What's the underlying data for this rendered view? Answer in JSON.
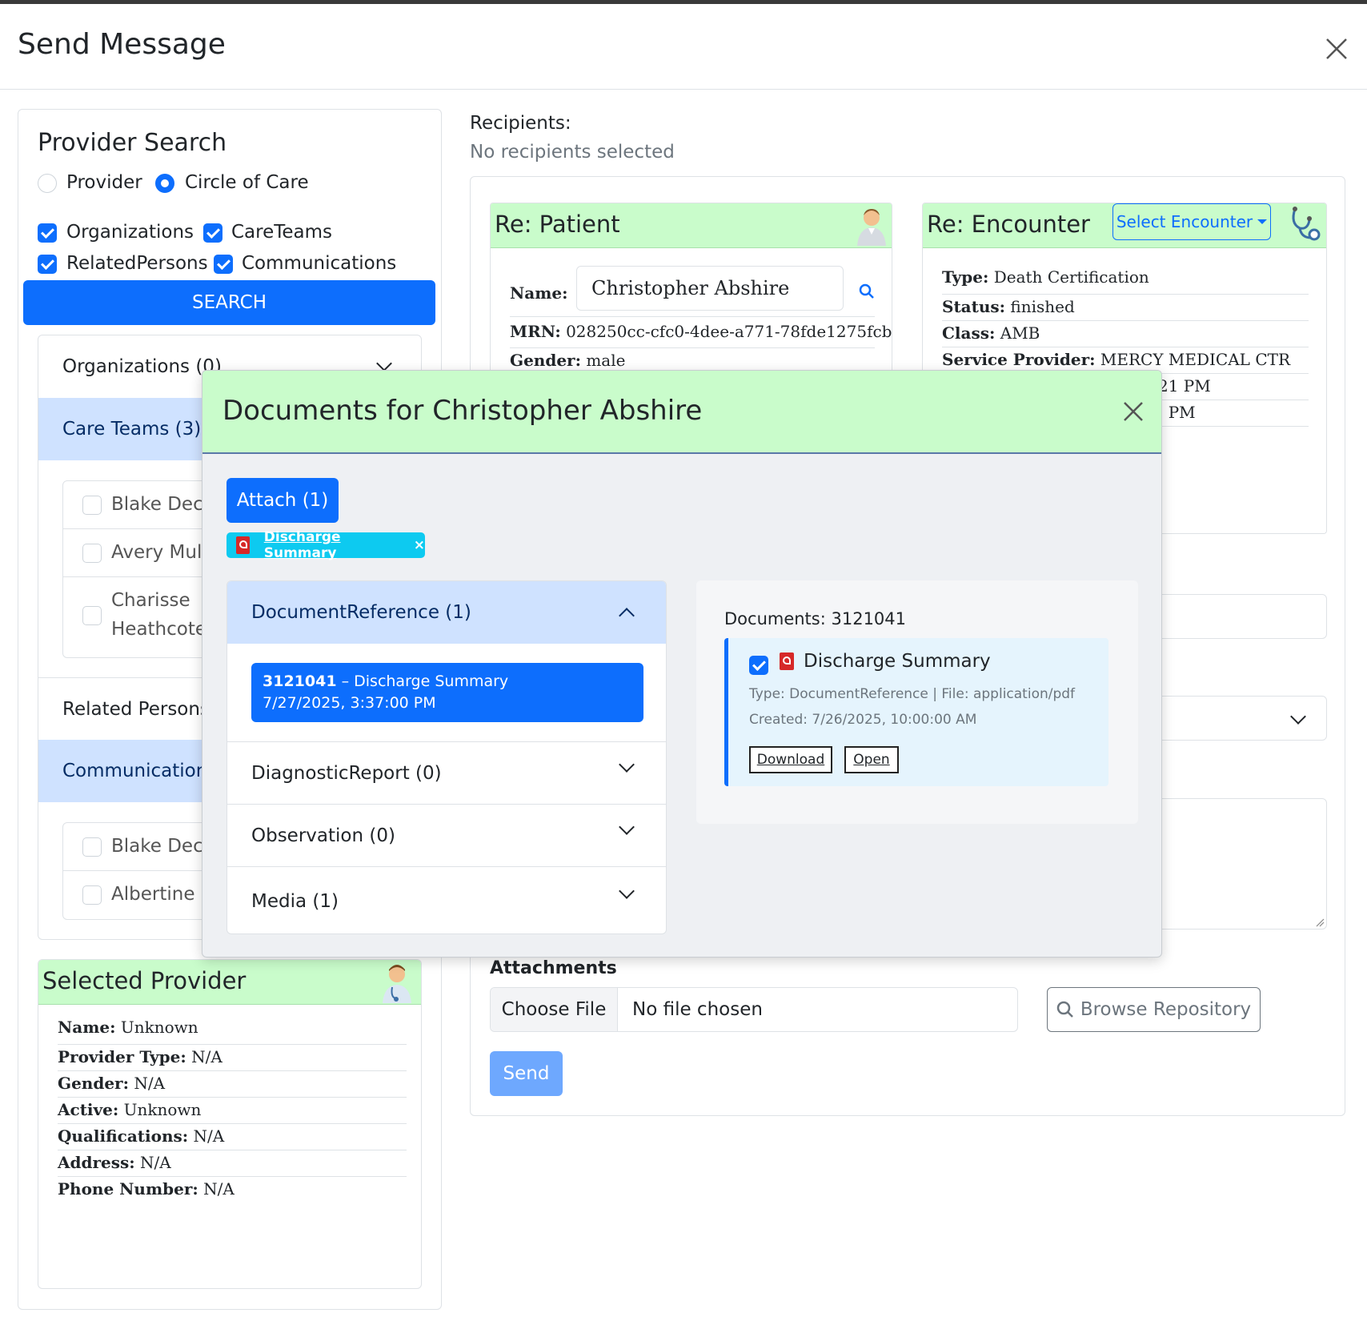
{
  "modal": {
    "title": "Send Message"
  },
  "provider_search": {
    "title": "Provider Search",
    "radios": [
      {
        "label": "Provider",
        "checked": false
      },
      {
        "label": "Circle of Care",
        "checked": true
      }
    ],
    "checkboxes": [
      {
        "label": "Organizations"
      },
      {
        "label": "CareTeams"
      },
      {
        "label": "RelatedPersons"
      },
      {
        "label": "Communications"
      }
    ],
    "search_label": "SEARCH",
    "accordion": {
      "organizations": "Organizations (0)",
      "care_teams": "Care Teams (3)",
      "care_team_members": [
        "Blake Deck",
        "Avery Mull",
        "Charisse",
        "Heathcote"
      ],
      "related_persons": "Related Persons",
      "communications": "Communications",
      "communication_members": [
        "Blake Deck",
        "Albertine C"
      ]
    }
  },
  "selected_provider": {
    "title": "Selected Provider",
    "fields": [
      {
        "k": "Name:",
        "v": "Unknown"
      },
      {
        "k": "Provider Type:",
        "v": "N/A"
      },
      {
        "k": "Gender:",
        "v": "N/A"
      },
      {
        "k": "Active:",
        "v": "Unknown"
      },
      {
        "k": "Qualifications:",
        "v": "N/A"
      },
      {
        "k": "Address:",
        "v": "N/A"
      },
      {
        "k": "Phone Number:",
        "v": "N/A"
      }
    ]
  },
  "recipients": {
    "label": "Recipients:",
    "empty": "No recipients selected"
  },
  "patient": {
    "title": "Re: Patient",
    "name_label": "Name:",
    "name_value": "Christopher Abshire",
    "mrn_label": "MRN:",
    "mrn_value": "028250cc-cfc0-4dee-a771-78fde1275fcb",
    "gender_label": "Gender:",
    "gender_value": "male"
  },
  "encounter": {
    "title": "Re: Encounter",
    "select_label": "Select Encounter",
    "fields": [
      {
        "k": "Type:",
        "v": "Death Certification"
      },
      {
        "k": "Status:",
        "v": "finished"
      },
      {
        "k": "Class:",
        "v": "AMB"
      },
      {
        "k": "Service Provider:",
        "v": "MERCY MEDICAL CTR"
      }
    ],
    "partial_lines": [
      "21 PM",
      ". PM"
    ]
  },
  "attachments": {
    "label": "Attachments",
    "choose_file": "Choose File",
    "no_file": "No file chosen",
    "browse": "Browse Repository",
    "send": "Send"
  },
  "documents_dialog": {
    "title": "Documents for Christopher Abshire",
    "attach_label": "Attach (1)",
    "chip_label": "Discharge Summary",
    "chip_remove": "×",
    "sections": [
      {
        "label": "DocumentReference (1)",
        "expanded": true
      },
      {
        "label": "DiagnosticReport (0)",
        "expanded": false
      },
      {
        "label": "Observation (0)",
        "expanded": false
      },
      {
        "label": "Media (1)",
        "expanded": false
      }
    ],
    "selected_item": {
      "id": "3121041",
      "sep": " – ",
      "name": "Discharge Summary",
      "date": "7/27/2025, 3:37:00 PM"
    },
    "detail": {
      "heading": "Documents: 3121041",
      "name": "Discharge Summary",
      "meta1": "Type: DocumentReference | File: application/pdf",
      "meta2": "Created: 7/26/2025, 10:00:00 AM",
      "download": "Download",
      "open": "Open"
    }
  },
  "colors": {
    "primary": "#0d6efd",
    "green_header": "#c9fccb",
    "info": "#0dcaf0",
    "pdf_red": "#d62828"
  }
}
